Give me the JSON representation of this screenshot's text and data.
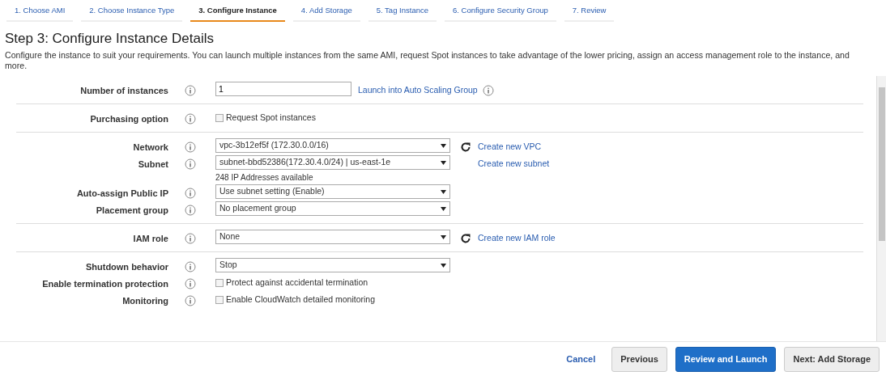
{
  "steps": [
    {
      "label": "1. Choose AMI",
      "selected": false
    },
    {
      "label": "2. Choose Instance Type",
      "selected": false
    },
    {
      "label": "3. Configure Instance",
      "selected": true
    },
    {
      "label": "4. Add Storage",
      "selected": false
    },
    {
      "label": "5. Tag Instance",
      "selected": false
    },
    {
      "label": "6. Configure Security Group",
      "selected": false
    },
    {
      "label": "7. Review",
      "selected": false
    }
  ],
  "title": "Step 3: Configure Instance Details",
  "description": "Configure the instance to suit your requirements. You can launch multiple instances from the same AMI, request Spot instances to take advantage of the lower pricing, assign an access management role to the instance, and more.",
  "groups": [
    {
      "rows": [
        {
          "label": "Number of instances",
          "kind": "text",
          "value": "1",
          "extras": [
            {
              "kind": "link",
              "text": "Launch into Auto Scaling Group"
            },
            {
              "kind": "info"
            }
          ]
        }
      ]
    },
    {
      "rows": [
        {
          "label": "Purchasing option",
          "kind": "checkbox",
          "value": "Request Spot instances",
          "checked": false
        }
      ]
    },
    {
      "rows": [
        {
          "label": "Network",
          "kind": "select",
          "value": "vpc-3b12ef5f (172.30.0.0/16)",
          "extras": [
            {
              "kind": "refresh"
            },
            {
              "kind": "link",
              "text": "Create new VPC"
            }
          ]
        },
        {
          "label": "Subnet",
          "kind": "select",
          "value": "subnet-bbd52386(172.30.4.0/24) | us-east-1e",
          "note": "248 IP Addresses available",
          "extras": [
            {
              "kind": "spacer"
            },
            {
              "kind": "link",
              "text": "Create new subnet"
            }
          ]
        },
        {
          "label": "Auto-assign Public IP",
          "kind": "select",
          "value": "Use subnet setting (Enable)"
        },
        {
          "label": "Placement group",
          "kind": "select",
          "value": "No placement group"
        }
      ]
    },
    {
      "rows": [
        {
          "label": "IAM role",
          "kind": "select",
          "value": "None",
          "extras": [
            {
              "kind": "refresh"
            },
            {
              "kind": "link",
              "text": "Create new IAM role"
            }
          ]
        }
      ]
    },
    {
      "rows": [
        {
          "label": "Shutdown behavior",
          "kind": "select",
          "value": "Stop"
        },
        {
          "label": "Enable termination protection",
          "kind": "checkbox",
          "value": "Protect against accidental termination",
          "checked": false
        },
        {
          "label": "Monitoring",
          "kind": "checkbox",
          "value": "Enable CloudWatch detailed monitoring",
          "checked": false
        }
      ]
    }
  ],
  "buttons": [
    {
      "kind": "link",
      "label": "Cancel"
    },
    {
      "kind": "secondary",
      "label": "Previous"
    },
    {
      "kind": "primary",
      "label": "Review and Launch"
    },
    {
      "kind": "secondary",
      "label": "Next: Add Storage"
    }
  ]
}
